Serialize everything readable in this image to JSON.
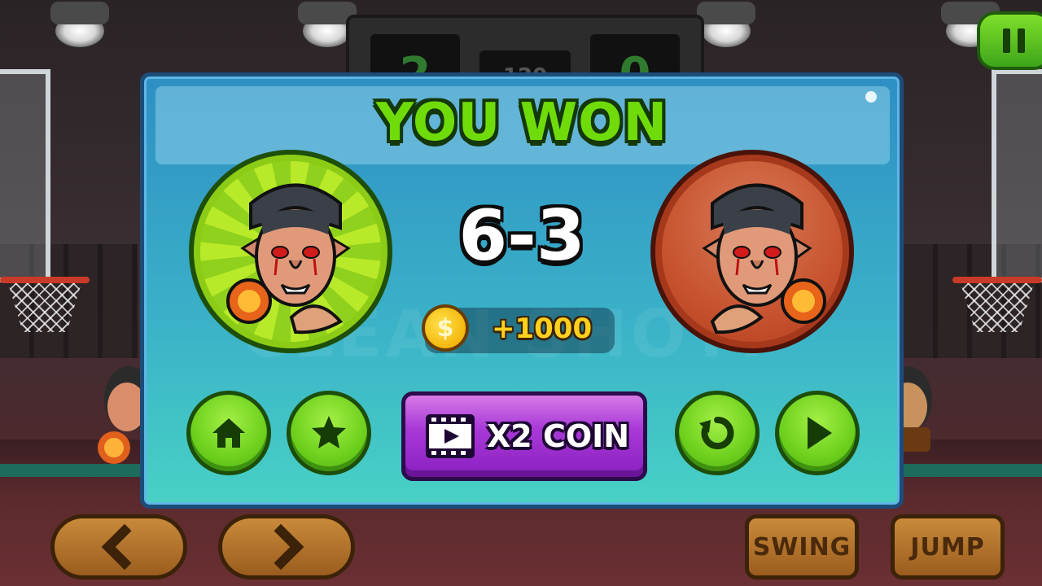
{
  "scoreboard": {
    "home": "2",
    "time": "120",
    "away": "0"
  },
  "modal": {
    "title": "YOU WON",
    "score": "6-3",
    "reward": "+1000",
    "x2_label": "X2 COIN",
    "ghost_text": "CLEAN SHOT!"
  },
  "controls": {
    "swing": "SWING",
    "jump": "JUMP"
  },
  "icons": {
    "pause": "pause-icon",
    "home": "home-icon",
    "star": "star-icon",
    "replay": "replay-icon",
    "next": "play-icon",
    "video": "video-icon",
    "coin": "coin-icon",
    "left": "chevron-left-icon",
    "right": "chevron-right-icon"
  },
  "colors": {
    "title_green": "#6fdc0a",
    "modal_blue": "#2e8fc4",
    "button_green": "#6ccf1c",
    "x2_purple": "#a93ad8",
    "coin_gold": "#ffd11e",
    "control_brown": "#c98a3a"
  }
}
